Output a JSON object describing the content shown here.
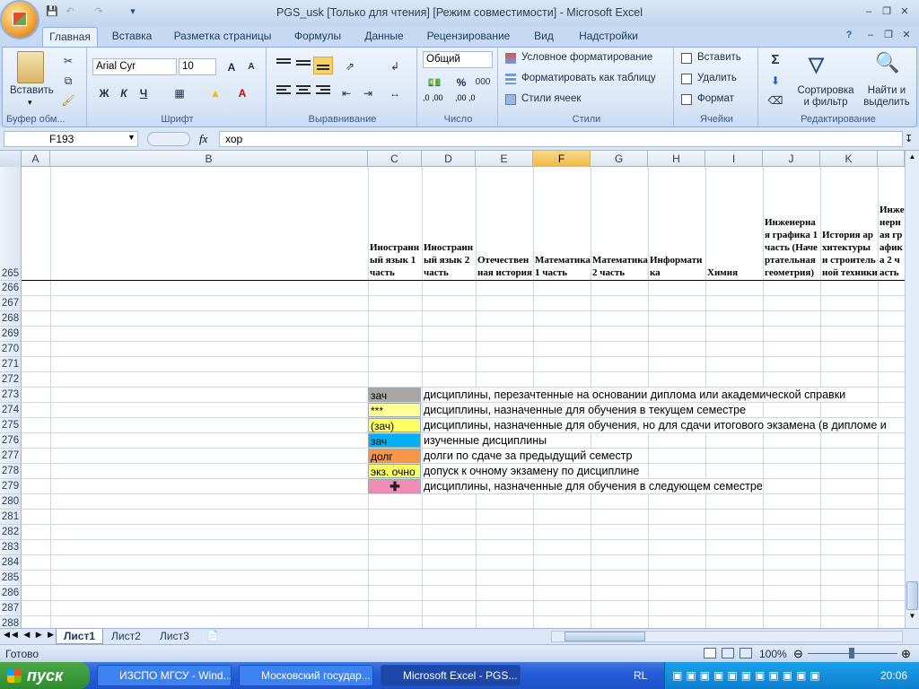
{
  "window": {
    "title": "PGS_usk  [Только для чтения]  [Режим совместимости] - Microsoft Excel"
  },
  "tabs": [
    "Главная",
    "Вставка",
    "Разметка страницы",
    "Формулы",
    "Данные",
    "Рецензирование",
    "Вид",
    "Надстройки"
  ],
  "ribbon": {
    "clipboard": {
      "paste": "Вставить",
      "label": "Буфер обм..."
    },
    "font": {
      "name": "Arial Cyr",
      "size": "10",
      "bold": "Ж",
      "italic": "К",
      "underline": "Ч",
      "label": "Шрифт",
      "grow": "A",
      "shrink": "A",
      "color_a": "A"
    },
    "align": {
      "label": "Выравнивание"
    },
    "number": {
      "format": "Общий",
      "percent": "%",
      "thousands": "000",
      "label": "Число",
      "inc": ",0 ,00",
      "dec": ",00 ,0"
    },
    "styles": {
      "conditional": "Условное форматирование",
      "table": "Форматировать как таблицу",
      "cell_styles": "Стили ячеек",
      "label": "Стили"
    },
    "cells": {
      "insert": "Вставить",
      "delete": "Удалить",
      "format": "Формат",
      "label": "Ячейки"
    },
    "editing": {
      "sort": "Сортировка и фильтр",
      "find": "Найти и выделить",
      "label": "Редактирование",
      "sigma": "Σ"
    }
  },
  "formula_bar": {
    "cell_ref": "F193",
    "fx": "fx",
    "value": "хор"
  },
  "columns": [
    "A",
    "B",
    "C",
    "D",
    "E",
    "F",
    "G",
    "H",
    "I",
    "J",
    "K"
  ],
  "selected_column": "F",
  "header_row": {
    "number": "265",
    "cells": [
      {
        "col": "C",
        "text": "Иностранный язык 1 часть"
      },
      {
        "col": "D",
        "text": "Иностранный язык 2 часть"
      },
      {
        "col": "E",
        "text": "Отечественная история"
      },
      {
        "col": "F",
        "text": "Математика 1 часть"
      },
      {
        "col": "G",
        "text": "Математика 2 часть"
      },
      {
        "col": "H",
        "text": "Информатика"
      },
      {
        "col": "I",
        "text": "Химия"
      },
      {
        "col": "J",
        "text": "Инженерная графика 1 часть (Начертательная геометрия)"
      },
      {
        "col": "K",
        "text": "История архитектуры и строительной техники"
      },
      {
        "col": "L",
        "text": "Инженерная графика 2 часть"
      }
    ]
  },
  "rows": [
    "266",
    "267",
    "268",
    "269",
    "270",
    "271",
    "272",
    "273",
    "274",
    "275",
    "276",
    "277",
    "278",
    "279",
    "280",
    "281",
    "282",
    "283",
    "284",
    "285",
    "286",
    "287",
    "288"
  ],
  "legend": [
    {
      "code": "зач",
      "color": "#a6a6a6",
      "text": "дисциплины, перезачтенные на основании диплома или академической справки"
    },
    {
      "code": "***",
      "color": "#ffff99",
      "text": "дисциплины, назначенные для обучения в текущем семестре"
    },
    {
      "code": "(зач)",
      "color": "#ffff66",
      "text": "дисциплины, назначенные для обучения, но для сдачи итогового экзамена (в дипломе и"
    },
    {
      "code": "зач",
      "color": "#00b0f0",
      "text": "изученные дисциплины"
    },
    {
      "code": "долг",
      "color": "#f79646",
      "text": "долги по сдаче за предыдущий семестр"
    },
    {
      "code": "экз. очно",
      "color": "#ffff66",
      "text": "допуск к очному экзамену по дисциплине"
    },
    {
      "code": "",
      "color": "#f28cb4",
      "text": "дисциплины, назначенные для обучения в следующем семестре"
    }
  ],
  "sheets": [
    "Лист1",
    "Лист2",
    "Лист3"
  ],
  "status": {
    "ready": "Готово",
    "zoom": "100%"
  },
  "taskbar": {
    "start": "пуск",
    "items": [
      "ИЗСПО МГСУ - Wind...",
      "Московский государ...",
      "Microsoft Excel - PGS..."
    ],
    "lang": "RL",
    "time": "20:06"
  }
}
